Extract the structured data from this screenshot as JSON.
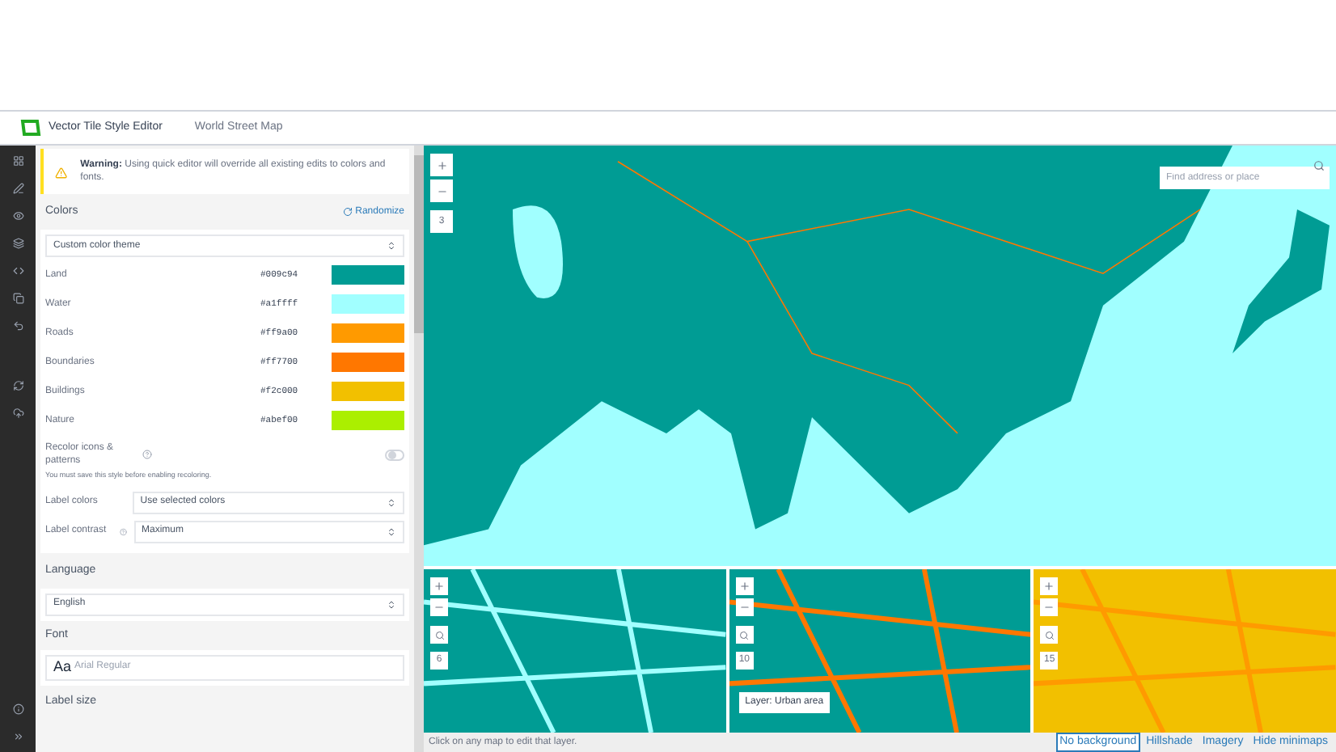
{
  "header": {
    "app_title": "Vector Tile Style Editor",
    "map_title": "World Street Map"
  },
  "warning": {
    "label": "Warning:",
    "text": "Using quick editor will override all existing edits to colors and fonts."
  },
  "colors": {
    "title": "Colors",
    "randomize": "Randomize",
    "theme": "Custom color theme",
    "items": [
      {
        "label": "Land",
        "hex": "#009c94",
        "color": "#009c94"
      },
      {
        "label": "Water",
        "hex": "#a1ffff",
        "color": "#a1ffff"
      },
      {
        "label": "Roads",
        "hex": "#ff9a00",
        "color": "#ff9a00"
      },
      {
        "label": "Boundaries",
        "hex": "#ff7700",
        "color": "#ff7700"
      },
      {
        "label": "Buildings",
        "hex": "#f2c000",
        "color": "#f2c000"
      },
      {
        "label": "Nature",
        "hex": "#abef00",
        "color": "#abef00"
      }
    ],
    "recolor": {
      "label": "Recolor icons & patterns",
      "on": false,
      "note": "You must save this style before enabling recoloring."
    },
    "label_colors": {
      "label": "Label colors",
      "value": "Use selected colors"
    },
    "label_contrast": {
      "label": "Label contrast",
      "value": "Maximum"
    }
  },
  "language": {
    "title": "Language",
    "value": "English"
  },
  "font": {
    "title": "Font",
    "sample": "Aa",
    "name": "Arial Regular"
  },
  "label_size": {
    "title": "Label size"
  },
  "map": {
    "search_placeholder": "Find address or place",
    "zoom_level": "3"
  },
  "minimaps": [
    {
      "zoom_level": "6"
    },
    {
      "zoom_level": "10",
      "tooltip": "Layer: Urban area"
    },
    {
      "zoom_level": "15"
    }
  ],
  "footer": {
    "hint": "Click on any map to edit that layer.",
    "links": [
      {
        "label": "No background",
        "selected": true
      },
      {
        "label": "Hillshade",
        "selected": false
      },
      {
        "label": "Imagery",
        "selected": false
      },
      {
        "label": "Hide minimaps",
        "selected": false
      }
    ]
  }
}
